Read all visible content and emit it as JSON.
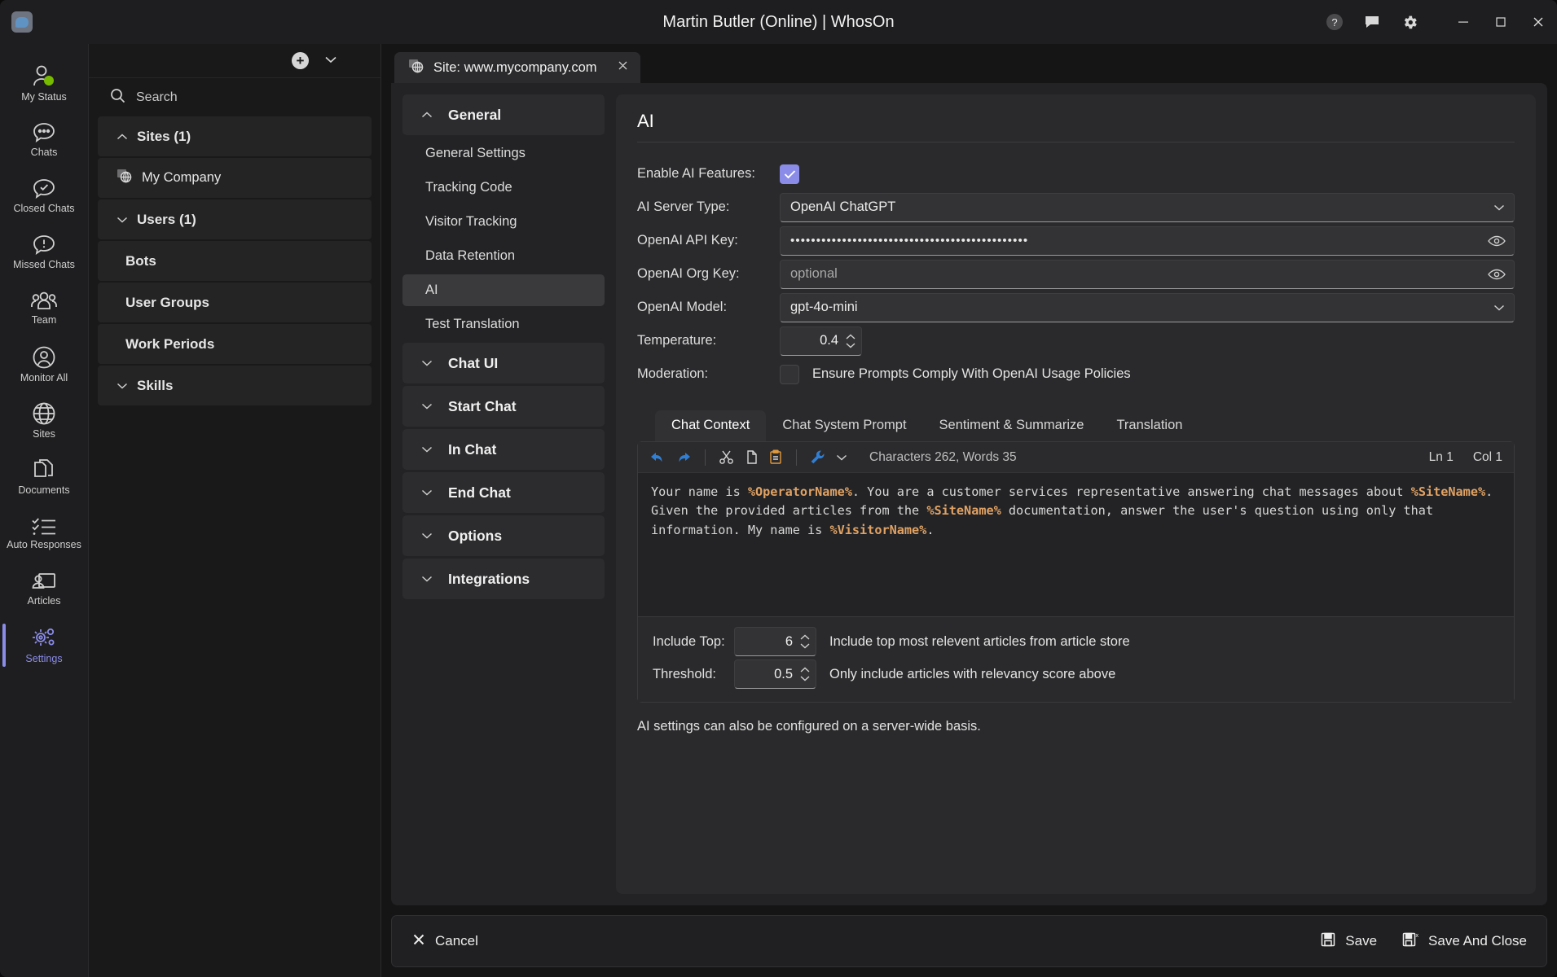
{
  "window": {
    "title": "Martin Butler (Online)  | WhosOn",
    "controls": {
      "help": "help-icon",
      "feedback": "feedback-icon",
      "settings": "gear-icon",
      "minimize": "minimize-icon",
      "maximize": "maximize-icon",
      "close": "close-icon"
    }
  },
  "rail": {
    "items": [
      {
        "label": "My Status",
        "icon": "person-status-icon",
        "active": false
      },
      {
        "label": "Chats",
        "icon": "chat-bubble-icon",
        "active": false
      },
      {
        "label": "Closed Chats",
        "icon": "chat-check-icon",
        "active": false
      },
      {
        "label": "Missed Chats",
        "icon": "chat-alert-icon",
        "active": false
      },
      {
        "label": "Team",
        "icon": "people-icon",
        "active": false
      },
      {
        "label": "Monitor All",
        "icon": "person-circle-icon",
        "active": false
      },
      {
        "label": "Sites",
        "icon": "globe-icon",
        "active": false
      },
      {
        "label": "Documents",
        "icon": "documents-icon",
        "active": false
      },
      {
        "label": "Auto Responses",
        "icon": "checklist-icon",
        "active": false
      },
      {
        "label": "Articles",
        "icon": "article-person-icon",
        "active": false
      },
      {
        "label": "Settings",
        "icon": "gears-icon",
        "active": true
      }
    ],
    "accent": "#8b8ce8"
  },
  "listpanel": {
    "add_label": "+",
    "search_placeholder": "Search",
    "rows": [
      {
        "label": "Sites (1)",
        "type": "group",
        "chev": "up"
      },
      {
        "label": "My Company",
        "type": "site",
        "icon": "site-globe-icon"
      },
      {
        "label": "Users (1)",
        "type": "group",
        "chev": "down"
      },
      {
        "label": "Bots",
        "type": "child"
      },
      {
        "label": "User Groups",
        "type": "child"
      },
      {
        "label": "Work Periods",
        "type": "child"
      },
      {
        "label": "Skills",
        "type": "group",
        "chev": "down"
      }
    ]
  },
  "doctab": {
    "label": "Site: www.mycompany.com",
    "icon": "site-globe-icon",
    "close": "×"
  },
  "settings_tree": [
    {
      "label": "General",
      "type": "group",
      "chev": "up"
    },
    {
      "label": "General Settings",
      "type": "leaf",
      "active": false
    },
    {
      "label": "Tracking Code",
      "type": "leaf",
      "active": false
    },
    {
      "label": "Visitor Tracking",
      "type": "leaf",
      "active": false
    },
    {
      "label": "Data Retention",
      "type": "leaf",
      "active": false
    },
    {
      "label": "AI",
      "type": "leaf",
      "active": true
    },
    {
      "label": "Test Translation",
      "type": "leaf",
      "active": false
    },
    {
      "label": "Chat UI",
      "type": "group",
      "chev": "down"
    },
    {
      "label": "Start Chat",
      "type": "group",
      "chev": "down"
    },
    {
      "label": "In Chat",
      "type": "group",
      "chev": "down"
    },
    {
      "label": "End Chat",
      "type": "group",
      "chev": "down"
    },
    {
      "label": "Options",
      "type": "group",
      "chev": "down"
    },
    {
      "label": "Integrations",
      "type": "group",
      "chev": "down"
    }
  ],
  "ai": {
    "title": "AI",
    "enable_label": "Enable AI Features:",
    "enable_checked": true,
    "server_type_label": "AI Server Type:",
    "server_type_value": "OpenAI ChatGPT",
    "api_key_label": "OpenAI API Key:",
    "api_key_value": "••••••••••••••••••••••••••••••••••••••••••••••",
    "org_key_label": "OpenAI Org Key:",
    "org_key_placeholder": "optional",
    "model_label": "OpenAI Model:",
    "model_value": "gpt-4o-mini",
    "temperature_label": "Temperature:",
    "temperature_value": "0.4",
    "moderation_label": "Moderation:",
    "moderation_text": "Ensure Prompts Comply With OpenAI Usage Policies",
    "moderation_checked": false,
    "note": "AI settings can also be configured on a server-wide basis."
  },
  "editor": {
    "tabs": [
      {
        "label": "Chat Context",
        "active": true
      },
      {
        "label": "Chat System Prompt",
        "active": false
      },
      {
        "label": "Sentiment & Summarize",
        "active": false
      },
      {
        "label": "Translation",
        "active": false
      }
    ],
    "toolbar": {
      "undo": "undo-icon",
      "redo": "redo-icon",
      "cut": "cut-icon",
      "copy": "copy-icon",
      "paste": "paste-icon",
      "tools": "wrench-icon",
      "tools_chevron": "chevron-down-icon",
      "stats": "Characters 262, Words 35",
      "line": "Ln 1",
      "col": "Col 1"
    },
    "content_segments": [
      {
        "t": "Your name is ",
        "tok": false
      },
      {
        "t": "%OperatorName%",
        "tok": true
      },
      {
        "t": ". You are a customer services representative answering chat messages about ",
        "tok": false
      },
      {
        "t": "%SiteName%",
        "tok": true
      },
      {
        "t": ". Given the provided articles from the ",
        "tok": false
      },
      {
        "t": "%SiteName%",
        "tok": true
      },
      {
        "t": " documentation, answer the user's question using only that information. My name is ",
        "tok": false
      },
      {
        "t": "%VisitorName%",
        "tok": true
      },
      {
        "t": ".",
        "tok": false
      }
    ],
    "include_top_label": "Include Top:",
    "include_top_value": "6",
    "include_top_desc": "Include top most relevent articles from article store",
    "threshold_label": "Threshold:",
    "threshold_value": "0.5",
    "threshold_desc": "Only include articles with relevancy score above"
  },
  "footer": {
    "cancel": "Cancel",
    "save": "Save",
    "save_and_close": "Save And Close"
  }
}
